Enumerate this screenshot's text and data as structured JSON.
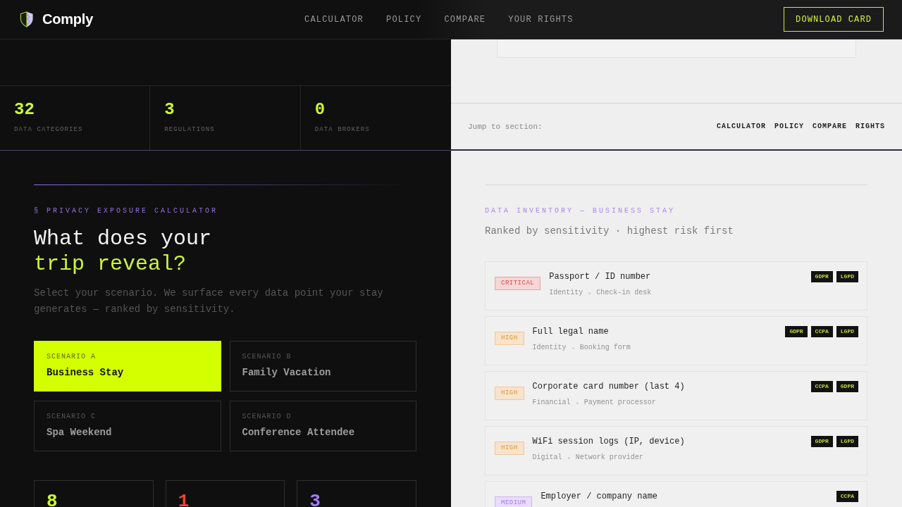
{
  "header": {
    "brand": "Comply",
    "nav": [
      "CALCULATOR",
      "POLICY",
      "COMPARE",
      "YOUR RIGHTS"
    ],
    "button": "DOWNLOAD CARD"
  },
  "stats": [
    {
      "value": "32",
      "label": "DATA CATEGORIES"
    },
    {
      "value": "3",
      "label": "REGULATIONS"
    },
    {
      "value": "0",
      "label": "DATA BROKERS"
    }
  ],
  "calculator": {
    "eyebrow": "§ PRIVACY EXPOSURE CALCULATOR",
    "heading": "What does your",
    "heading_highlight": "trip reveal?",
    "description": "Select your scenario. We surface every data point your stay generates — ranked by sensitivity.",
    "scenarios": [
      {
        "label": "SCENARIO A",
        "title": "Business Stay",
        "selected": true
      },
      {
        "label": "SCENARIO B",
        "title": "Family Vacation",
        "selected": false
      },
      {
        "label": "SCENARIO C",
        "title": "Spa Weekend",
        "selected": false
      },
      {
        "label": "SCENARIO D",
        "title": "Conference Attendee",
        "selected": false
      }
    ],
    "summary": [
      {
        "value": "8",
        "color": "#cdf53a"
      },
      {
        "value": "1",
        "color": "#e8453c"
      },
      {
        "value": "3",
        "color": "#a27cf2"
      }
    ]
  },
  "jump_bar": {
    "label": "Jump to section:",
    "links": [
      "CALCULATOR",
      "POLICY",
      "COMPARE",
      "RIGHTS"
    ]
  },
  "inventory": {
    "eyebrow": "DATA INVENTORY — BUSINESS STAY",
    "subtitle": "Ranked by sensitivity · highest risk first",
    "items": [
      {
        "kind": "critical",
        "badge": "CRITICAL",
        "title": "Passport / ID number",
        "category": "Identity",
        "source": "Check-in desk",
        "regulations": [
          "GDPR",
          "LGPD"
        ]
      },
      {
        "kind": "high",
        "badge": "HIGH",
        "title": "Full legal name",
        "category": "Identity",
        "source": "Booking form",
        "regulations": [
          "GDPR",
          "CCPA",
          "LGPD"
        ]
      },
      {
        "kind": "high",
        "badge": "HIGH",
        "title": "Corporate card number (last 4)",
        "category": "Financial",
        "source": "Payment processor",
        "regulations": [
          "CCPA",
          "GDPR"
        ]
      },
      {
        "kind": "high",
        "badge": "HIGH",
        "title": "WiFi session logs (IP, device)",
        "category": "Digital",
        "source": "Network provider",
        "regulations": [
          "GDPR",
          "LGPD"
        ]
      },
      {
        "kind": "medium",
        "badge": "MEDIUM",
        "title": "Employer / company name",
        "regulations": [
          "CCPA"
        ]
      }
    ]
  }
}
